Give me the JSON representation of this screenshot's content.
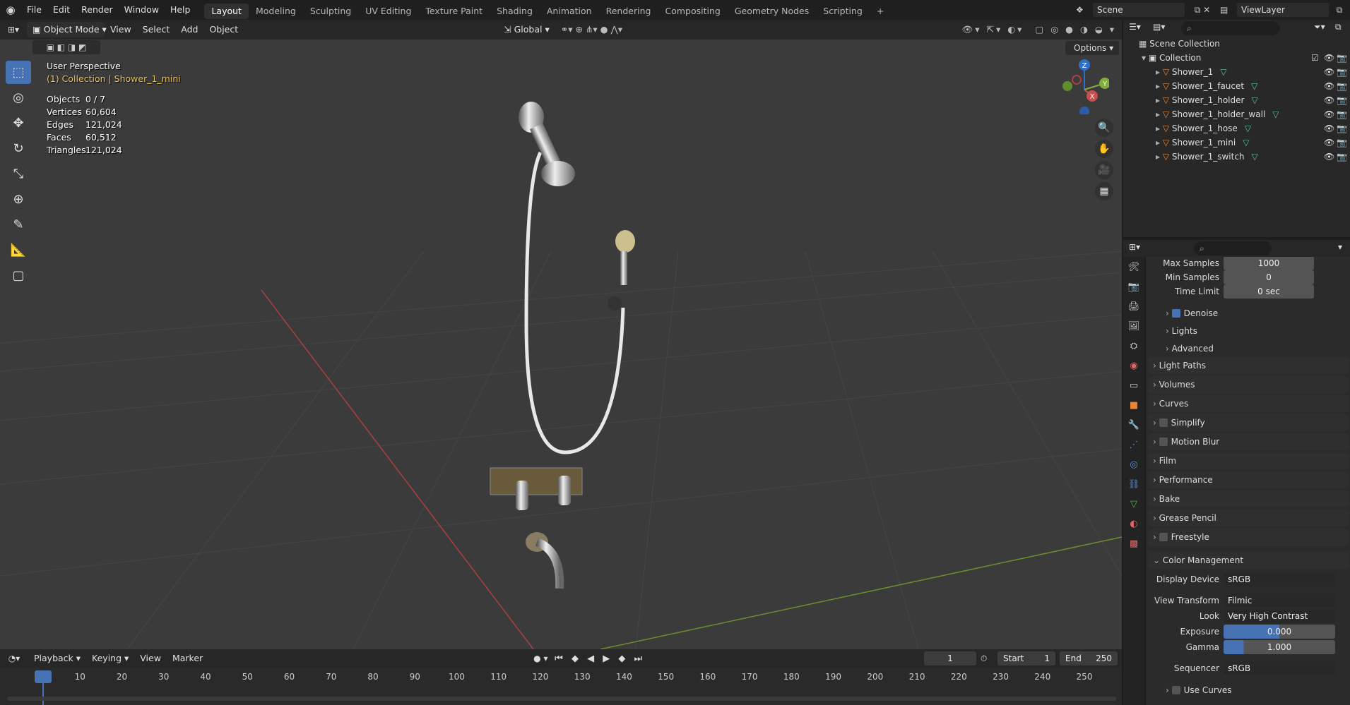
{
  "topbar": {
    "menus": [
      "File",
      "Edit",
      "Render",
      "Window",
      "Help"
    ],
    "workspaces": [
      "Layout",
      "Modeling",
      "Sculpting",
      "UV Editing",
      "Texture Paint",
      "Shading",
      "Animation",
      "Rendering",
      "Compositing",
      "Geometry Nodes",
      "Scripting"
    ],
    "active_workspace": "Layout",
    "add_tab": "+",
    "scene": "Scene",
    "view_layer": "ViewLayer"
  },
  "viewport_header": {
    "mode": "Object Mode",
    "menus": [
      "View",
      "Select",
      "Add",
      "Object"
    ],
    "transform_orientation": "Global",
    "options": "Options"
  },
  "viewport": {
    "perspective": "User Perspective",
    "collection_info": "(1) Collection | Shower_1_mini",
    "stats": [
      {
        "label": "Objects",
        "value": "0 / 7"
      },
      {
        "label": "Vertices",
        "value": "60,604"
      },
      {
        "label": "Edges",
        "value": "121,024"
      },
      {
        "label": "Faces",
        "value": "60,512"
      },
      {
        "label": "Triangles",
        "value": "121,024"
      }
    ],
    "gizmo": {
      "z": "Z",
      "x": "X",
      "y": "Y"
    },
    "tools": [
      "select-box",
      "cursor",
      "move",
      "rotate",
      "scale",
      "transform",
      "annotate",
      "measure",
      "add-cube"
    ]
  },
  "timeline": {
    "menus": [
      "Playback",
      "Keying",
      "View",
      "Marker"
    ],
    "current_frame": "1",
    "start_label": "Start",
    "start": "1",
    "end_label": "End",
    "end": "250",
    "ticks": [
      "1",
      "10",
      "20",
      "30",
      "40",
      "50",
      "60",
      "70",
      "80",
      "90",
      "100",
      "110",
      "120",
      "130",
      "140",
      "150",
      "160",
      "170",
      "180",
      "190",
      "200",
      "210",
      "220",
      "230",
      "240",
      "250"
    ]
  },
  "outliner": {
    "root": "Scene Collection",
    "collection": "Collection",
    "items": [
      "Shower_1",
      "Shower_1_faucet",
      "Shower_1_holder",
      "Shower_1_holder_wall",
      "Shower_1_hose",
      "Shower_1_mini",
      "Shower_1_switch"
    ]
  },
  "properties": {
    "max_samples_label": "Max Samples",
    "max_samples": "1000",
    "min_samples_label": "Min Samples",
    "min_samples": "0",
    "time_limit_label": "Time Limit",
    "time_limit": "0 sec",
    "denoise": "Denoise",
    "lights": "Lights",
    "advanced": "Advanced",
    "panels": [
      "Light Paths",
      "Volumes",
      "Curves",
      "Simplify",
      "Motion Blur",
      "Film",
      "Performance",
      "Bake",
      "Grease Pencil",
      "Freestyle"
    ],
    "color_management": "Color Management",
    "display_device_label": "Display Device",
    "display_device": "sRGB",
    "view_transform_label": "View Transform",
    "view_transform": "Filmic",
    "look_label": "Look",
    "look": "Very High Contrast",
    "exposure_label": "Exposure",
    "exposure": "0.000",
    "gamma_label": "Gamma",
    "gamma": "1.000",
    "sequencer_label": "Sequencer",
    "sequencer": "sRGB",
    "use_curves": "Use Curves"
  },
  "colors": {
    "accent": "#4772b3",
    "x_axis": "#c94f4f",
    "y_axis": "#7fae3a",
    "z_axis": "#2f6fc8",
    "highlight_text": "#f2c14e"
  }
}
